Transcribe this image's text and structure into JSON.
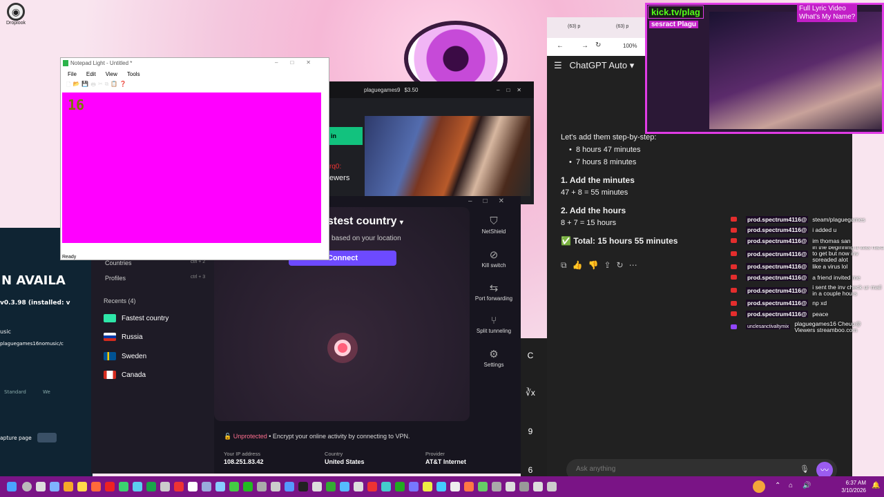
{
  "desktop": {
    "icon_label": "Droplook"
  },
  "notepad": {
    "title": "Notepad Light - Untitled *",
    "menu": [
      "File",
      "Edit",
      "View",
      "Tools"
    ],
    "content": "16",
    "status": "Ready"
  },
  "stream_app": {
    "channel": "plaguegames9",
    "balance": "$3.50",
    "left_label": "in",
    "left_text1": "rq0:",
    "left_text2": "ewers"
  },
  "left_panel": {
    "banner": "N AVAILA",
    "version": "v0.3.98 (installed: v",
    "music_label": "usic",
    "path": "plaguegames16nomusic/c",
    "tab_standard": "Standard",
    "tab_other": "We",
    "capture_button": "apture page"
  },
  "vpn": {
    "title": "stest country",
    "subtitle": "based on your location",
    "connect_label": "Connect",
    "nav": [
      {
        "label": "Countries",
        "shortcut": "ctrl + 2"
      },
      {
        "label": "Profiles",
        "shortcut": "ctrl + 3"
      }
    ],
    "recents_header": "Recents (4)",
    "recents": [
      {
        "label": "Fastest country",
        "color": "#2ee6a8"
      },
      {
        "label": "Russia",
        "color": "#d52b1e"
      },
      {
        "label": "Sweden",
        "color": "#005293"
      },
      {
        "label": "Canada",
        "color": "#d52b1e"
      }
    ],
    "tools": [
      {
        "label": "NetShield",
        "icon": "shield-icon"
      },
      {
        "label": "Kill switch",
        "icon": "kill-switch-icon"
      },
      {
        "label": "Port forwarding",
        "icon": "port-icon"
      },
      {
        "label": "Split tunneling",
        "icon": "split-icon"
      },
      {
        "label": "Settings",
        "icon": "gear-icon"
      }
    ],
    "status_label": "Unprotected",
    "status_text": "Encrypt your online activity by connecting to VPN.",
    "ip_label": "Your IP address",
    "ip_value": "108.251.83.42",
    "country_label": "Country",
    "country_value": "United States",
    "provider_label": "Provider",
    "provider_value": "AT&T Internet"
  },
  "calc": {
    "keys": [
      "C",
      "∛x",
      "9",
      "6"
    ]
  },
  "browser": {
    "tabs": [
      "(63) p",
      "(63) p"
    ],
    "zoom": "100%",
    "chat_title": "ChatGPT Auto",
    "intro": "Let's add them step-by-step:",
    "bullets": [
      "8 hours 47 minutes",
      "7 hours 8 minutes"
    ],
    "step1_title": "1. Add the minutes",
    "step1_text": "47 + 8 = 55 minutes",
    "step2_title": "2. Add the hours",
    "step2_text": "8 + 7 = 15 hours",
    "total": "✅ Total: 15 hours 55 minutes",
    "input_placeholder": "Ask anything"
  },
  "stream_overlay": {
    "kick_label": "kick.tv/plag",
    "sub_label": "sesract Plagu",
    "song_line1": "Full Lyric Video",
    "song_line2": "What's My Name?"
  },
  "twitch_chat": [
    {
      "user": "prod.spectrum4116@",
      "text": "steam/plaguegames"
    },
    {
      "user": "prod.spectrum4116@",
      "text": "i added u"
    },
    {
      "user": "prod.spectrum4116@",
      "text": "im thomas san"
    },
    {
      "user": "prod.spectrum4116@",
      "text": "in the beginning it was hard to get but now inv spreaded alot"
    },
    {
      "user": "prod.spectrum4116@",
      "text": "like a virus lol"
    },
    {
      "user": "prod.spectrum4116@",
      "text": "a friend invited me"
    },
    {
      "user": "prod.spectrum4116@",
      "text": "i sent the inv check ur mail in a couple hours"
    },
    {
      "user": "prod.spectrum4116@",
      "text": "np xd"
    },
    {
      "user": "prod.spectrum4116@",
      "text": "peace"
    },
    {
      "user": "unclesanctivaltymix",
      "text": "plaguegames16 Cheup@ Viewers streamboo.com"
    }
  ],
  "taskbar": {
    "time": "6:37 AM",
    "date": "3/10/2026"
  }
}
